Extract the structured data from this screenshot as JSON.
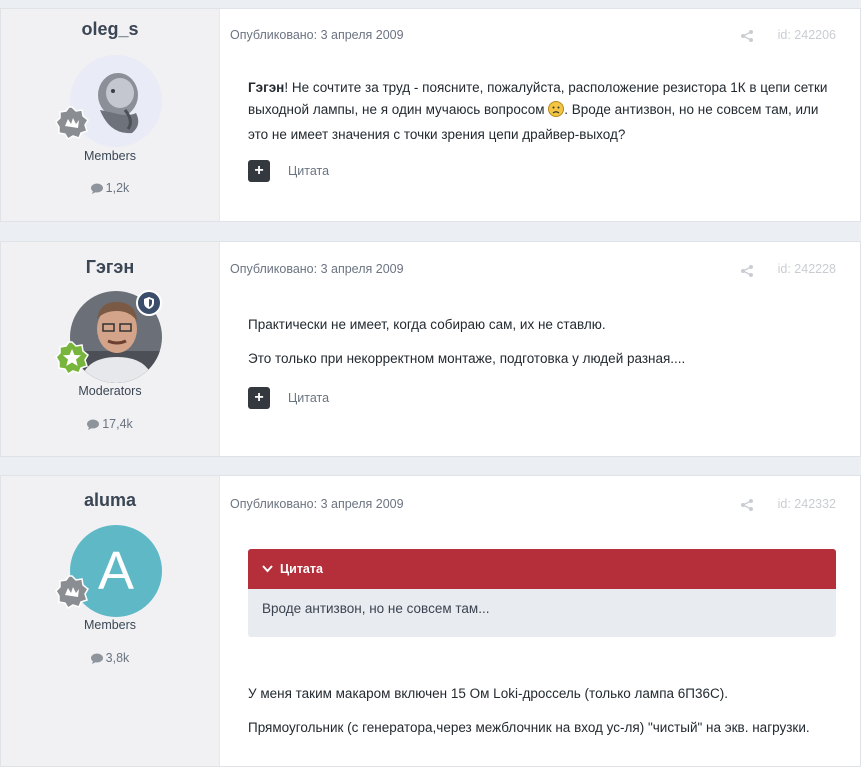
{
  "posts": [
    {
      "author": "oleg_s",
      "group": "Members",
      "post_count": "1,2k",
      "published": "Опубликовано: 3 апреля 2009",
      "id": "id: 242206",
      "body_bold": "Гэгэн",
      "body_rest": "! Не сочтите за труд - поясните, пожалуйста, расположение резистора 1К в цепи сетки выходной лампы, не я один мучаюсь вопросом ",
      "body_rest2": ". Вроде антизвон, но не совсем там, или это не имеет значения с точки зрения цепи драйвер-выход?",
      "quote_label": "Цитата"
    },
    {
      "author": "Гэгэн",
      "group": "Moderators",
      "post_count": "17,4k",
      "published": "Опубликовано: 3 апреля 2009",
      "id": "id: 242228",
      "para1": "Практически не имеет, когда собираю сам, их не ставлю.",
      "para2": "Это только при некорректном монтаже, подготовка у людей разная....",
      "quote_label": "Цитата"
    },
    {
      "author": "aluma",
      "avatar_letter": "A",
      "group": "Members",
      "post_count": "3,8k",
      "published": "Опубликовано: 3 апреля 2009",
      "id": "id: 242332",
      "quote_header": "Цитата",
      "quote_text": "Вроде антизвон, но не совсем там...",
      "para1": "У меня таким макаром включен 15 Ом Loki-дроссель (только лампа 6П36С).",
      "para2": "Прямоугольник (с генератора,через межблочник на вход ус-ля) \"чистый\" на экв. нагрузки."
    }
  ],
  "colors": {
    "quote_red": "#b52f3a",
    "moderator_badge": "#3a4d6b",
    "aluma_avatar": "#5fb8c6"
  }
}
